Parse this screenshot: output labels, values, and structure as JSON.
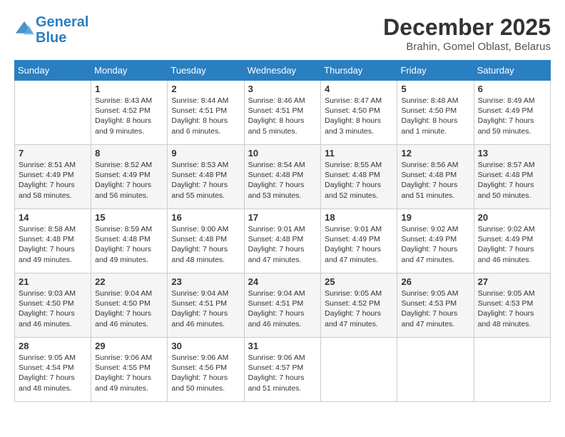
{
  "header": {
    "logo_line1": "General",
    "logo_line2": "Blue",
    "month": "December 2025",
    "location": "Brahin, Gomel Oblast, Belarus"
  },
  "days_of_week": [
    "Sunday",
    "Monday",
    "Tuesday",
    "Wednesday",
    "Thursday",
    "Friday",
    "Saturday"
  ],
  "weeks": [
    [
      {
        "day": "",
        "sunrise": "",
        "sunset": "",
        "daylight": ""
      },
      {
        "day": "1",
        "sunrise": "Sunrise: 8:43 AM",
        "sunset": "Sunset: 4:52 PM",
        "daylight": "Daylight: 8 hours and 9 minutes."
      },
      {
        "day": "2",
        "sunrise": "Sunrise: 8:44 AM",
        "sunset": "Sunset: 4:51 PM",
        "daylight": "Daylight: 8 hours and 6 minutes."
      },
      {
        "day": "3",
        "sunrise": "Sunrise: 8:46 AM",
        "sunset": "Sunset: 4:51 PM",
        "daylight": "Daylight: 8 hours and 5 minutes."
      },
      {
        "day": "4",
        "sunrise": "Sunrise: 8:47 AM",
        "sunset": "Sunset: 4:50 PM",
        "daylight": "Daylight: 8 hours and 3 minutes."
      },
      {
        "day": "5",
        "sunrise": "Sunrise: 8:48 AM",
        "sunset": "Sunset: 4:50 PM",
        "daylight": "Daylight: 8 hours and 1 minute."
      },
      {
        "day": "6",
        "sunrise": "Sunrise: 8:49 AM",
        "sunset": "Sunset: 4:49 PM",
        "daylight": "Daylight: 7 hours and 59 minutes."
      }
    ],
    [
      {
        "day": "7",
        "sunrise": "Sunrise: 8:51 AM",
        "sunset": "Sunset: 4:49 PM",
        "daylight": "Daylight: 7 hours and 58 minutes."
      },
      {
        "day": "8",
        "sunrise": "Sunrise: 8:52 AM",
        "sunset": "Sunset: 4:49 PM",
        "daylight": "Daylight: 7 hours and 56 minutes."
      },
      {
        "day": "9",
        "sunrise": "Sunrise: 8:53 AM",
        "sunset": "Sunset: 4:48 PM",
        "daylight": "Daylight: 7 hours and 55 minutes."
      },
      {
        "day": "10",
        "sunrise": "Sunrise: 8:54 AM",
        "sunset": "Sunset: 4:48 PM",
        "daylight": "Daylight: 7 hours and 53 minutes."
      },
      {
        "day": "11",
        "sunrise": "Sunrise: 8:55 AM",
        "sunset": "Sunset: 4:48 PM",
        "daylight": "Daylight: 7 hours and 52 minutes."
      },
      {
        "day": "12",
        "sunrise": "Sunrise: 8:56 AM",
        "sunset": "Sunset: 4:48 PM",
        "daylight": "Daylight: 7 hours and 51 minutes."
      },
      {
        "day": "13",
        "sunrise": "Sunrise: 8:57 AM",
        "sunset": "Sunset: 4:48 PM",
        "daylight": "Daylight: 7 hours and 50 minutes."
      }
    ],
    [
      {
        "day": "14",
        "sunrise": "Sunrise: 8:58 AM",
        "sunset": "Sunset: 4:48 PM",
        "daylight": "Daylight: 7 hours and 49 minutes."
      },
      {
        "day": "15",
        "sunrise": "Sunrise: 8:59 AM",
        "sunset": "Sunset: 4:48 PM",
        "daylight": "Daylight: 7 hours and 49 minutes."
      },
      {
        "day": "16",
        "sunrise": "Sunrise: 9:00 AM",
        "sunset": "Sunset: 4:48 PM",
        "daylight": "Daylight: 7 hours and 48 minutes."
      },
      {
        "day": "17",
        "sunrise": "Sunrise: 9:01 AM",
        "sunset": "Sunset: 4:48 PM",
        "daylight": "Daylight: 7 hours and 47 minutes."
      },
      {
        "day": "18",
        "sunrise": "Sunrise: 9:01 AM",
        "sunset": "Sunset: 4:49 PM",
        "daylight": "Daylight: 7 hours and 47 minutes."
      },
      {
        "day": "19",
        "sunrise": "Sunrise: 9:02 AM",
        "sunset": "Sunset: 4:49 PM",
        "daylight": "Daylight: 7 hours and 47 minutes."
      },
      {
        "day": "20",
        "sunrise": "Sunrise: 9:02 AM",
        "sunset": "Sunset: 4:49 PM",
        "daylight": "Daylight: 7 hours and 46 minutes."
      }
    ],
    [
      {
        "day": "21",
        "sunrise": "Sunrise: 9:03 AM",
        "sunset": "Sunset: 4:50 PM",
        "daylight": "Daylight: 7 hours and 46 minutes."
      },
      {
        "day": "22",
        "sunrise": "Sunrise: 9:04 AM",
        "sunset": "Sunset: 4:50 PM",
        "daylight": "Daylight: 7 hours and 46 minutes."
      },
      {
        "day": "23",
        "sunrise": "Sunrise: 9:04 AM",
        "sunset": "Sunset: 4:51 PM",
        "daylight": "Daylight: 7 hours and 46 minutes."
      },
      {
        "day": "24",
        "sunrise": "Sunrise: 9:04 AM",
        "sunset": "Sunset: 4:51 PM",
        "daylight": "Daylight: 7 hours and 46 minutes."
      },
      {
        "day": "25",
        "sunrise": "Sunrise: 9:05 AM",
        "sunset": "Sunset: 4:52 PM",
        "daylight": "Daylight: 7 hours and 47 minutes."
      },
      {
        "day": "26",
        "sunrise": "Sunrise: 9:05 AM",
        "sunset": "Sunset: 4:53 PM",
        "daylight": "Daylight: 7 hours and 47 minutes."
      },
      {
        "day": "27",
        "sunrise": "Sunrise: 9:05 AM",
        "sunset": "Sunset: 4:53 PM",
        "daylight": "Daylight: 7 hours and 48 minutes."
      }
    ],
    [
      {
        "day": "28",
        "sunrise": "Sunrise: 9:05 AM",
        "sunset": "Sunset: 4:54 PM",
        "daylight": "Daylight: 7 hours and 48 minutes."
      },
      {
        "day": "29",
        "sunrise": "Sunrise: 9:06 AM",
        "sunset": "Sunset: 4:55 PM",
        "daylight": "Daylight: 7 hours and 49 minutes."
      },
      {
        "day": "30",
        "sunrise": "Sunrise: 9:06 AM",
        "sunset": "Sunset: 4:56 PM",
        "daylight": "Daylight: 7 hours and 50 minutes."
      },
      {
        "day": "31",
        "sunrise": "Sunrise: 9:06 AM",
        "sunset": "Sunset: 4:57 PM",
        "daylight": "Daylight: 7 hours and 51 minutes."
      },
      {
        "day": "",
        "sunrise": "",
        "sunset": "",
        "daylight": ""
      },
      {
        "day": "",
        "sunrise": "",
        "sunset": "",
        "daylight": ""
      },
      {
        "day": "",
        "sunrise": "",
        "sunset": "",
        "daylight": ""
      }
    ]
  ]
}
